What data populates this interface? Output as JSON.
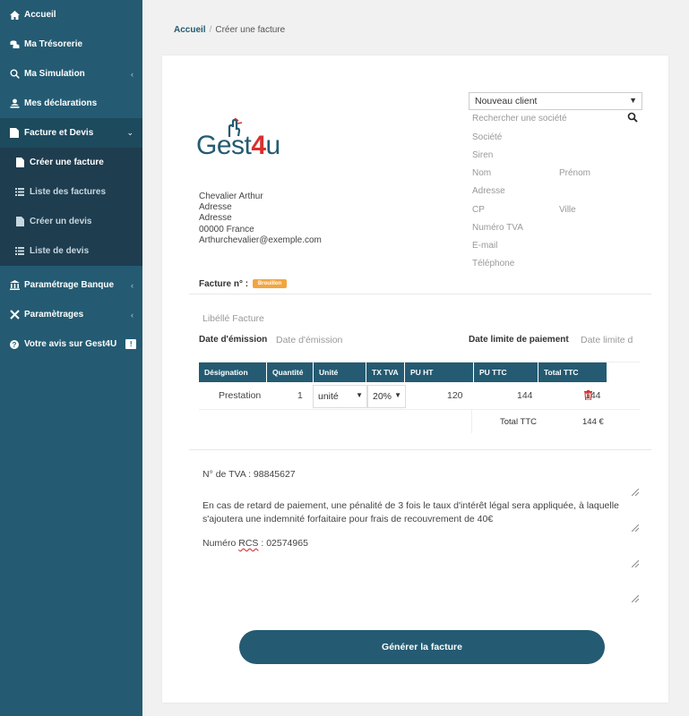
{
  "sidebar": {
    "items": [
      {
        "label": "Accueil",
        "icon": "home-icon"
      },
      {
        "label": "Ma Trésorerie",
        "icon": "coins-icon"
      },
      {
        "label": "Ma Simulation",
        "icon": "search-icon"
      },
      {
        "label": "Mes déclarations",
        "icon": "user-upload-icon"
      },
      {
        "label": "Facture et Devis",
        "icon": "document-icon"
      }
    ],
    "submenu": [
      {
        "label": "Créer une facture",
        "icon": "file-icon"
      },
      {
        "label": "Liste des factures",
        "icon": "list-icon"
      },
      {
        "label": "Créer un devis",
        "icon": "file-icon"
      },
      {
        "label": "Liste de devis",
        "icon": "list-icon"
      }
    ],
    "bottom": [
      {
        "label": "Paramétrage Banque",
        "icon": "bank-icon"
      },
      {
        "label": "Paramètrages",
        "icon": "tools-icon"
      },
      {
        "label": "Votre avis sur Gest4U",
        "icon": "question-icon",
        "badge": "!"
      }
    ]
  },
  "breadcrumb": {
    "home": "Accueil",
    "current": "Créer une facture"
  },
  "logo": {
    "text_a": "Gest",
    "text_b": "4",
    "text_c": "u"
  },
  "sender": {
    "name": "Chevalier Arthur",
    "address1": "Adresse",
    "address2": "Adresse",
    "city": "00000 France",
    "email": "Arthurchevalier@exemple.com"
  },
  "client": {
    "select": "Nouveau client",
    "search": "Rechercher une société",
    "societe": "Société",
    "siren": "Siren",
    "nom": "Nom",
    "prenom": "Prénom",
    "adresse": "Adresse",
    "cp": "CP",
    "ville": "Ville",
    "tva": "Numéro TVA",
    "email": "E-mail",
    "telephone": "Téléphone"
  },
  "invoice": {
    "number_label": "Facture n° :",
    "status": "Brouillon",
    "libelle_placeholder": "Libéllé Facture",
    "emission_label": "Date d'émission",
    "emission_placeholder": "Date d'émission",
    "due_label": "Date limite de paiement",
    "due_placeholder": "Date limite d"
  },
  "table": {
    "headers": [
      "Désignation",
      "Quantité",
      "Unité",
      "TX TVA",
      "PU HT",
      "PU TTC",
      "Total TTC"
    ],
    "row": {
      "designation": "Prestation",
      "quantite": "1",
      "unite": "unité",
      "tva": "20%",
      "pu_ht": "120",
      "pu_ttc": "144",
      "total_ttc": "144"
    },
    "total_label": "Total TTC",
    "total_value": "144 €"
  },
  "notes": {
    "tva": "N° de TVA : 98845627",
    "penalty": "En cas de retard de paiement, une pénalité de 3 fois le taux d'intérêt légal sera appliquée, à laquelle s'ajoutera une indemnité forfaitaire pour frais de recouvrement de 40€",
    "rcs_prefix": "Numéro ",
    "rcs_word": "RCS",
    "rcs_value": " : 02574965"
  },
  "actions": {
    "generate": "Générer la facture"
  },
  "colors": {
    "primary": "#245b72",
    "accent": "#f3a53f",
    "danger": "#d9302f"
  }
}
